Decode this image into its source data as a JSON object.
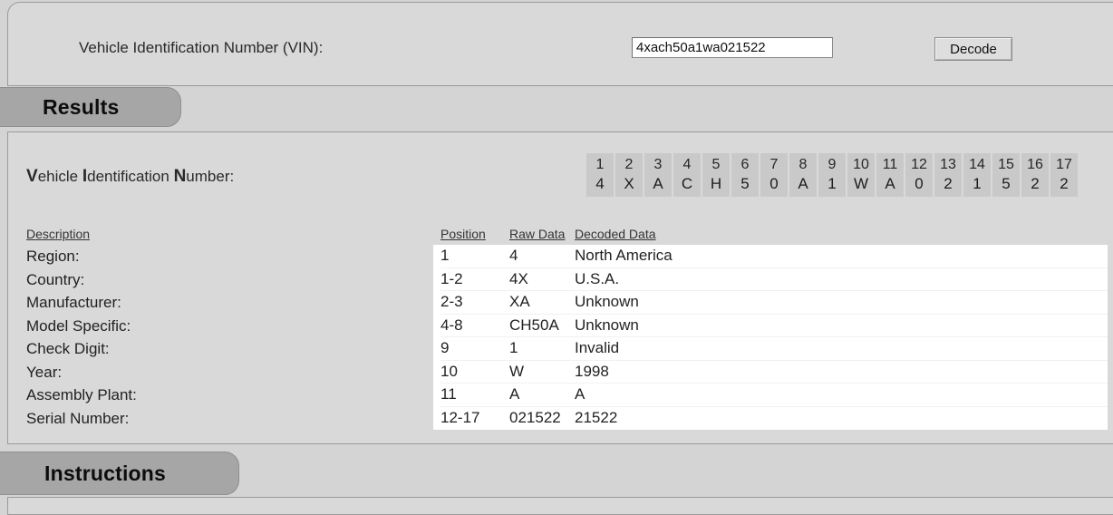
{
  "input_panel": {
    "vin_label": "Vehicle Identification Number (VIN):",
    "vin_value": "4xach50a1wa021522",
    "vin_placeholder": "",
    "decode_label": "Decode"
  },
  "tabs": [
    {
      "id": "results",
      "label": "Results"
    },
    {
      "id": "instructions",
      "label": "Instructions"
    }
  ],
  "results": {
    "vin_title_parts": [
      "V",
      "ehicle ",
      "I",
      "dentification ",
      "N",
      "umber:"
    ],
    "vin_title_plain": "Vehicle Identification Number:",
    "vin_cells": [
      {
        "position": "1",
        "char": "4"
      },
      {
        "position": "2",
        "char": "X"
      },
      {
        "position": "3",
        "char": "A"
      },
      {
        "position": "4",
        "char": "C"
      },
      {
        "position": "5",
        "char": "H"
      },
      {
        "position": "6",
        "char": "5"
      },
      {
        "position": "7",
        "char": "0"
      },
      {
        "position": "8",
        "char": "A"
      },
      {
        "position": "9",
        "char": "1"
      },
      {
        "position": "10",
        "char": "W"
      },
      {
        "position": "11",
        "char": "A"
      },
      {
        "position": "12",
        "char": "0"
      },
      {
        "position": "13",
        "char": "2"
      },
      {
        "position": "14",
        "char": "1"
      },
      {
        "position": "15",
        "char": "5"
      },
      {
        "position": "16",
        "char": "2"
      },
      {
        "position": "17",
        "char": "2"
      }
    ],
    "description_header": "Description",
    "table_headers": {
      "position": "Position",
      "raw": "Raw Data",
      "decoded": "Decoded Data"
    },
    "rows": [
      {
        "description": "Region:",
        "position": "1",
        "raw": "4",
        "decoded": "North America"
      },
      {
        "description": "Country:",
        "position": "1-2",
        "raw": "4X",
        "decoded": "U.S.A."
      },
      {
        "description": "Manufacturer:",
        "position": "2-3",
        "raw": "XA",
        "decoded": "Unknown"
      },
      {
        "description": "Model Specific:",
        "position": "4-8",
        "raw": "CH50A",
        "decoded": "Unknown"
      },
      {
        "description": "Check Digit:",
        "position": "9",
        "raw": "1",
        "decoded": "Invalid"
      },
      {
        "description": "Year:",
        "position": "10",
        "raw": "W",
        "decoded": "1998"
      },
      {
        "description": "Assembly Plant:",
        "position": "11",
        "raw": "A",
        "decoded": "A"
      },
      {
        "description": "Serial Number:",
        "position": "12-17",
        "raw": "021522",
        "decoded": "21522"
      }
    ]
  },
  "colors": {
    "page_background": "#d4d4d4",
    "panel_background": "#d9d9d9",
    "tab_background": "#a6a6a6",
    "cell_background": "#c9c9c9",
    "table_background": "#ffffff",
    "border": "#9b9b9b"
  }
}
